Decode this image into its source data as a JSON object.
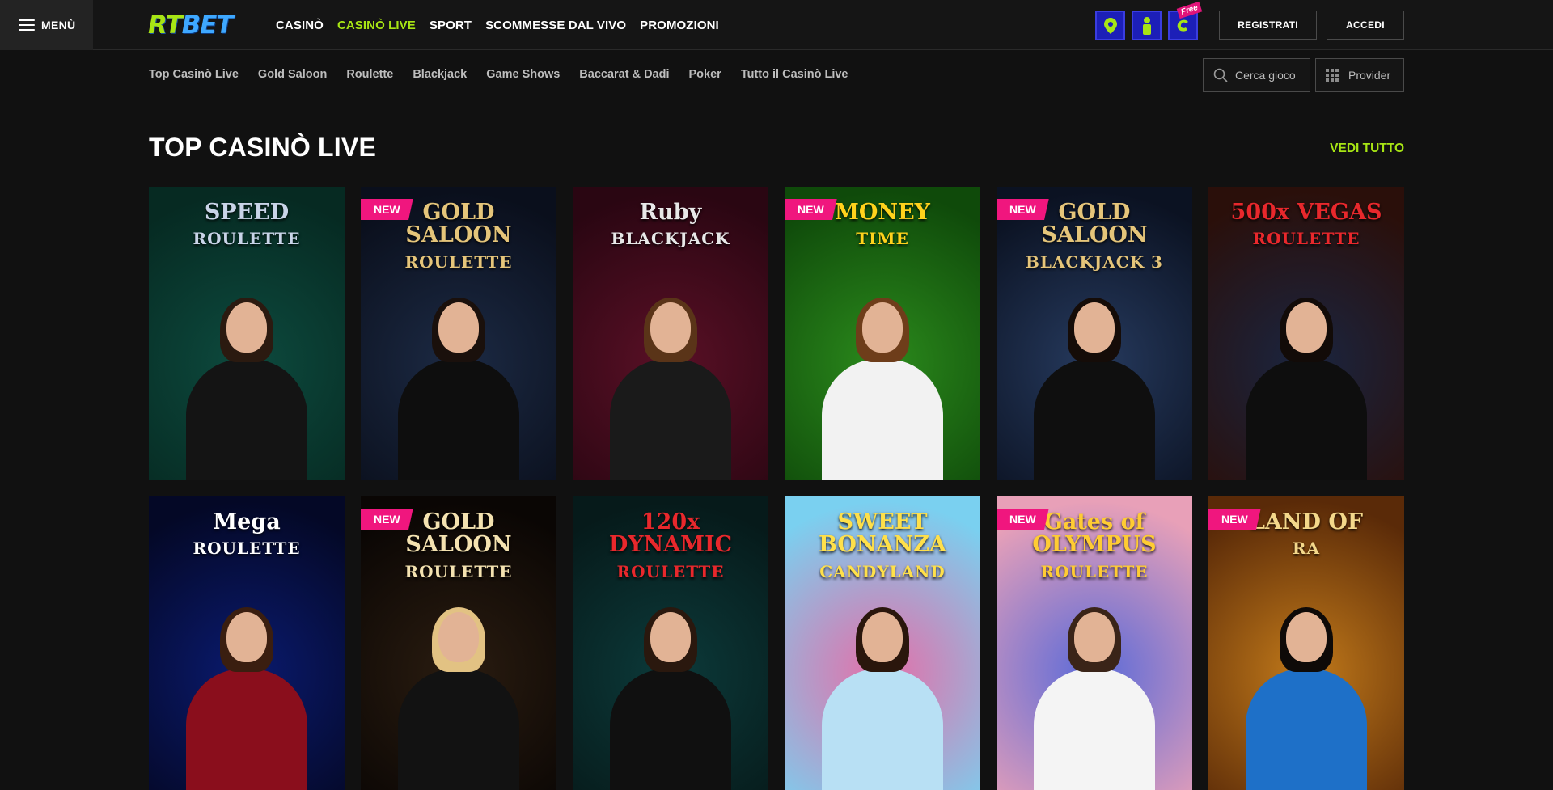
{
  "header": {
    "menu_label": "MENÙ",
    "logo": {
      "part1": "RT",
      "part2": "BET"
    },
    "nav": [
      {
        "label": "CASINÒ",
        "active": false
      },
      {
        "label": "CASINÒ LIVE",
        "active": true
      },
      {
        "label": "SPORT",
        "active": false
      },
      {
        "label": "SCOMMESSE DAL VIVO",
        "active": false
      },
      {
        "label": "PROMOZIONI",
        "active": false
      }
    ],
    "promo_icons": [
      "map-pin-icon",
      "player-icon",
      "free-spin-icon"
    ],
    "free_tag": "Free",
    "register_label": "REGISTRATI",
    "login_label": "ACCEDI"
  },
  "subnav": {
    "items": [
      "Top Casinò Live",
      "Gold Saloon",
      "Roulette",
      "Blackjack",
      "Game Shows",
      "Baccarat & Dadi",
      "Poker",
      "Tutto il Casinò Live"
    ],
    "search_placeholder": "Cerca gioco",
    "provider_label": "Provider"
  },
  "section": {
    "title": "TOP CASINÒ LIVE",
    "see_all": "VEDI TUTTO"
  },
  "badge_text": "NEW",
  "games": [
    {
      "t1": "SPEED",
      "t2": "ROULETTE",
      "is_new": false,
      "bg": "#0d4a3e",
      "bg2": "#062a22",
      "accent": "#c9d4e8",
      "hair": "#2b1a10",
      "body": "#141414"
    },
    {
      "t1": "GOLD SALOON",
      "t2": "ROULETTE",
      "is_new": true,
      "bg": "#1c2a44",
      "bg2": "#0a0f1c",
      "accent": "#e5c57a",
      "hair": "#1a100c",
      "body": "#0e0e0e"
    },
    {
      "t1": "Ruby",
      "t2": "BLACKJACK",
      "is_new": false,
      "bg": "#5a1026",
      "bg2": "#2a0612",
      "accent": "#e8e8e8",
      "hair": "#5a3418",
      "body": "#1a1a1a"
    },
    {
      "t1": "MONEY",
      "t2": "TIME",
      "is_new": true,
      "bg": "#2b8a1c",
      "bg2": "#0f4a0a",
      "accent": "#ffd21c",
      "hair": "#6e3d1a",
      "body": "#f2f2f2"
    },
    {
      "t1": "GOLD SALOON",
      "t2": "BLACKJACK 3",
      "is_new": true,
      "bg": "#263a5e",
      "bg2": "#0b1222",
      "accent": "#e5c57a",
      "hair": "#150c08",
      "body": "#0f0f0f"
    },
    {
      "t1": "500x VEGAS",
      "t2": "ROULETTE",
      "is_new": false,
      "bg": "#1a2540",
      "bg2": "#2a0f0a",
      "accent": "#e8282c",
      "hair": "#120b08",
      "body": "#0e0e0e"
    },
    {
      "t1": "Mega",
      "t2": "ROULETTE",
      "is_new": false,
      "bg": "#0a1a6e",
      "bg2": "#040826",
      "accent": "#ffffff",
      "hair": "#3a1e10",
      "body": "#8a0e1c"
    },
    {
      "t1": "GOLD SALOON",
      "t2": "ROULETTE",
      "is_new": true,
      "bg": "#2a1c10",
      "bg2": "#0a0604",
      "accent": "#f4e2b0",
      "hair": "#e2c283",
      "body": "#121212"
    },
    {
      "t1": "120x DYNAMIC",
      "t2": "ROULETTE",
      "is_new": false,
      "bg": "#0c3a3a",
      "bg2": "#061a1a",
      "accent": "#e8282c",
      "hair": "#2a180e",
      "body": "#101010"
    },
    {
      "t1": "SWEET BONANZA",
      "t2": "CANDYLAND",
      "is_new": false,
      "bg": "#e46fa8",
      "bg2": "#7ad0f0",
      "accent": "#ffe04a",
      "hair": "#2a160c",
      "body": "#b8e0f4"
    },
    {
      "t1": "Gates of OLYMPUS",
      "t2": "ROULETTE",
      "is_new": true,
      "bg": "#5a6ad8",
      "bg2": "#e8a0b8",
      "accent": "#ffcc33",
      "hair": "#3a2418",
      "body": "#f4f4f4"
    },
    {
      "t1": "LAND OF",
      "t2": "RA",
      "is_new": true,
      "bg": "#c27a1a",
      "bg2": "#5a2a08",
      "accent": "#f4d88a",
      "hair": "#0e0a08",
      "body": "#1e70c8"
    }
  ]
}
